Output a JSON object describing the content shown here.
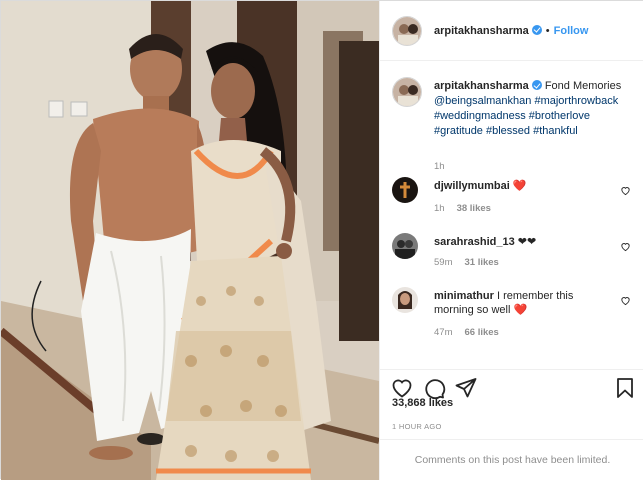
{
  "header": {
    "username": "arpitakhansharma",
    "separator": "•",
    "follow_label": "Follow"
  },
  "caption": {
    "username": "arpitakhansharma",
    "text": "Fond Memories",
    "tags": [
      "@beingsalmankhan",
      "#majorthrowback",
      "#weddingmadness",
      "#brotherlove",
      "#gratitude",
      "#blessed",
      "#thankful"
    ],
    "time": "1h"
  },
  "comments": [
    {
      "username": "djwillymumbai",
      "text": "❤️",
      "time": "1h",
      "likes": "38 likes"
    },
    {
      "username": "sarahrashid_13",
      "text": "❤❤",
      "time": "59m",
      "likes": "31 likes"
    },
    {
      "username": "minimathur",
      "text": "I remember this morning so well ❤️",
      "time": "47m",
      "likes": "66 likes"
    }
  ],
  "actions": {
    "like_icon": "heart-outline-icon",
    "comment_icon": "comment-bubble-icon",
    "share_icon": "paper-plane-icon",
    "save_icon": "bookmark-icon"
  },
  "stats": {
    "likes": "33,868 likes",
    "posted": "1 HOUR AGO"
  },
  "footer": {
    "limited_text": "Comments on this post have been limited."
  },
  "colors": {
    "link_blue": "#3897f0",
    "hashtag": "#00376b",
    "muted": "#8e8e8e",
    "border": "#efefef"
  }
}
